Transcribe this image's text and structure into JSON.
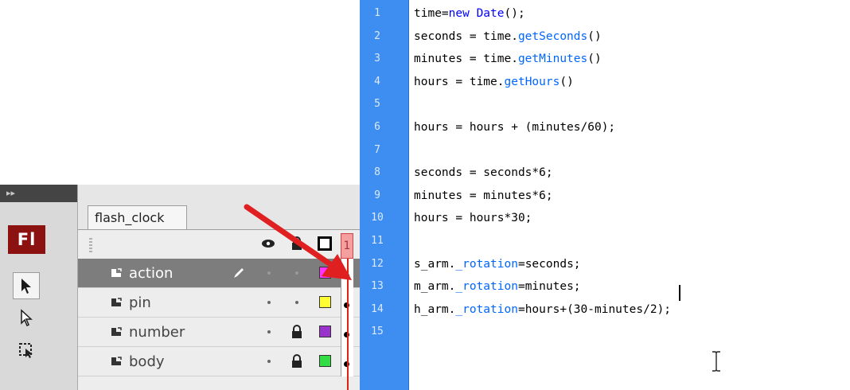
{
  "tools": {
    "header_glyph": "▸▸",
    "logo_text": "Fl",
    "items": [
      "selection-tool",
      "subselection-tool",
      "free-transform-tool"
    ]
  },
  "timeline": {
    "tab_label": "flash_clock",
    "frame_number": "1",
    "layers": [
      {
        "name": "action",
        "color": "#ff33ff",
        "active": true,
        "locked": false
      },
      {
        "name": "pin",
        "color": "#ffff33",
        "active": false,
        "locked": false
      },
      {
        "name": "number",
        "color": "#9933cc",
        "active": false,
        "locked": true
      },
      {
        "name": "body",
        "color": "#33dd44",
        "active": false,
        "locked": true
      }
    ]
  },
  "editor": {
    "line_numbers": [
      "1",
      "2",
      "3",
      "4",
      "5",
      "6",
      "7",
      "8",
      "9",
      "10",
      "11",
      "12",
      "13",
      "14",
      "15"
    ],
    "lines": [
      [
        {
          "t": "time="
        },
        {
          "t": "new Date",
          "c": "kw"
        },
        {
          "t": "();"
        }
      ],
      [
        {
          "t": "seconds = time."
        },
        {
          "t": "getSeconds",
          "c": "fn"
        },
        {
          "t": "()"
        }
      ],
      [
        {
          "t": "minutes = time."
        },
        {
          "t": "getMinutes",
          "c": "fn"
        },
        {
          "t": "()"
        }
      ],
      [
        {
          "t": "hours = time."
        },
        {
          "t": "getHours",
          "c": "fn"
        },
        {
          "t": "()"
        }
      ],
      [
        {
          "t": ""
        }
      ],
      [
        {
          "t": "hours = hours + (minutes/60);"
        }
      ],
      [
        {
          "t": ""
        }
      ],
      [
        {
          "t": "seconds = seconds*6;"
        }
      ],
      [
        {
          "t": "minutes = minutes*6;"
        }
      ],
      [
        {
          "t": "hours = hours*30;"
        }
      ],
      [
        {
          "t": ""
        }
      ],
      [
        {
          "t": "s_arm."
        },
        {
          "t": "_rotation",
          "c": "fn"
        },
        {
          "t": "=seconds;"
        }
      ],
      [
        {
          "t": "m_arm."
        },
        {
          "t": "_rotation",
          "c": "fn"
        },
        {
          "t": "=minutes;"
        }
      ],
      [
        {
          "t": "h_arm."
        },
        {
          "t": "_rotation",
          "c": "fn"
        },
        {
          "t": "=hours+(30-minutes/2);"
        }
      ],
      [
        {
          "t": ""
        }
      ]
    ]
  },
  "colors": {
    "gutter": "#3d8ef0",
    "keyword": "#0000ff",
    "property": "#0066ff",
    "logo_bg": "#8b1210",
    "arrow": "#e02020"
  }
}
